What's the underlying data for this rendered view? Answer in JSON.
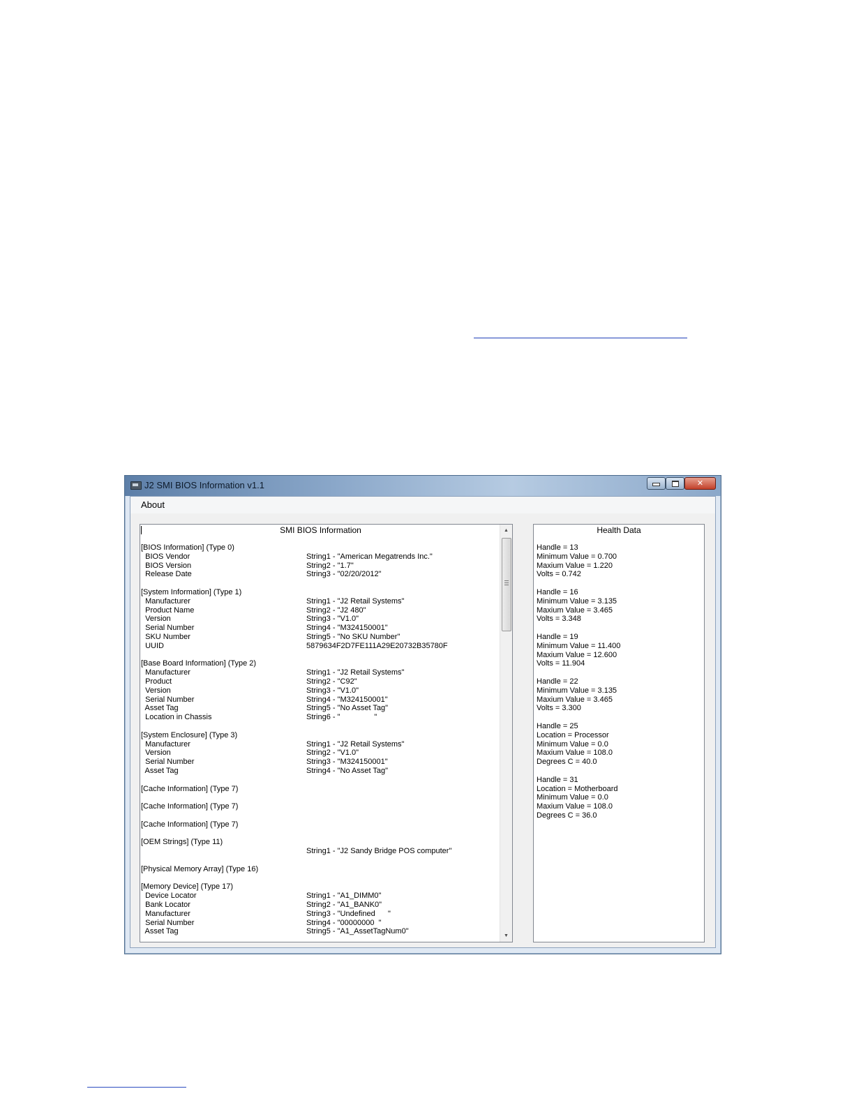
{
  "window": {
    "title": "J2 SMI BIOS Information v1.1",
    "menu": [
      "About"
    ]
  },
  "bios_panel": {
    "title": "SMI BIOS Information",
    "lines": [
      {
        "label": "[BIOS Information] (Type 0)",
        "value": ""
      },
      {
        "label": "  BIOS Vendor",
        "value": "String1 - \"American Megatrends Inc.\""
      },
      {
        "label": "  BIOS Version",
        "value": "String2 - \"1.7\""
      },
      {
        "label": "  Release Date",
        "value": "String3 - \"02/20/2012\""
      },
      {
        "label": "",
        "value": ""
      },
      {
        "label": "[System Information] (Type 1)",
        "value": ""
      },
      {
        "label": "  Manufacturer",
        "value": "String1 - \"J2 Retail Systems\""
      },
      {
        "label": "  Product Name",
        "value": "String2 - \"J2 480\""
      },
      {
        "label": "  Version",
        "value": "String3 - \"V1.0\""
      },
      {
        "label": "  Serial Number",
        "value": "String4 - \"M324150001\""
      },
      {
        "label": "  SKU Number",
        "value": "String5 - \"No SKU Number\""
      },
      {
        "label": "  UUID",
        "value": "5879634F2D7FE111A29E20732B35780F"
      },
      {
        "label": "",
        "value": ""
      },
      {
        "label": "[Base Board Information] (Type 2)",
        "value": ""
      },
      {
        "label": "  Manufacturer",
        "value": "String1 - \"J2 Retail Systems\""
      },
      {
        "label": "  Product",
        "value": "String2 - \"C92\""
      },
      {
        "label": "  Version",
        "value": "String3 - \"V1.0\""
      },
      {
        "label": "  Serial Number",
        "value": "String4 - \"M324150001\""
      },
      {
        "label": "  Asset Tag",
        "value": "String5 - \"No Asset Tag\""
      },
      {
        "label": "  Location in Chassis",
        "value": "String6 - \"                \""
      },
      {
        "label": "",
        "value": ""
      },
      {
        "label": "[System Enclosure] (Type 3)",
        "value": ""
      },
      {
        "label": "  Manufacturer",
        "value": "String1 - \"J2 Retail Systems\""
      },
      {
        "label": "  Version",
        "value": "String2 - \"V1.0\""
      },
      {
        "label": "  Serial Number",
        "value": "String3 - \"M324150001\""
      },
      {
        "label": "  Asset Tag",
        "value": "String4 - \"No Asset Tag\""
      },
      {
        "label": "",
        "value": ""
      },
      {
        "label": "[Cache Information] (Type 7)",
        "value": ""
      },
      {
        "label": "",
        "value": ""
      },
      {
        "label": "[Cache Information] (Type 7)",
        "value": ""
      },
      {
        "label": "",
        "value": ""
      },
      {
        "label": "[Cache Information] (Type 7)",
        "value": ""
      },
      {
        "label": "",
        "value": ""
      },
      {
        "label": "[OEM Strings] (Type 11)",
        "value": ""
      },
      {
        "label": "",
        "value": "String1 - \"J2 Sandy Bridge POS computer\""
      },
      {
        "label": "",
        "value": ""
      },
      {
        "label": "[Physical Memory Array] (Type 16)",
        "value": ""
      },
      {
        "label": "",
        "value": ""
      },
      {
        "label": "[Memory Device] (Type 17)",
        "value": ""
      },
      {
        "label": "  Device Locator",
        "value": "String1 - \"A1_DIMM0\""
      },
      {
        "label": "  Bank Locator",
        "value": "String2 - \"A1_BANK0\""
      },
      {
        "label": "  Manufacturer",
        "value": "String3 - \"Undefined      \""
      },
      {
        "label": "  Serial Number",
        "value": "String4 - \"00000000  \""
      },
      {
        "label": "  Asset Tag",
        "value": "String5 - \"A1_AssetTagNum0\""
      }
    ]
  },
  "health_panel": {
    "title": "Health Data",
    "lines": [
      "Handle = 13",
      "Minimum Value = 0.700",
      "Maxium Value = 1.220",
      "Volts = 0.742",
      "",
      "Handle = 16",
      "Minimum Value = 3.135",
      "Maxium Value = 3.465",
      "Volts = 3.348",
      "",
      "Handle = 19",
      "Minimum Value = 11.400",
      "Maxium Value = 12.600",
      "Volts = 11.904",
      "",
      "Handle = 22",
      "Minimum Value = 3.135",
      "Maxium Value = 3.465",
      "Volts = 3.300",
      "",
      "Handle = 25",
      "Location = Processor",
      "Minimum Value = 0.0",
      "Maxium Value = 108.0",
      "Degrees C = 40.0",
      "",
      "Handle = 31",
      "Location = Motherboard",
      "Minimum Value = 0.0",
      "Maxium Value = 108.0",
      "Degrees C = 36.0"
    ]
  },
  "icons": {
    "app": "app-icon",
    "minimize": "minimize-icon",
    "maximize": "maximize-icon",
    "close": "close-icon",
    "close_glyph": "✕",
    "scroll_up": "▲",
    "scroll_down": "▼"
  }
}
